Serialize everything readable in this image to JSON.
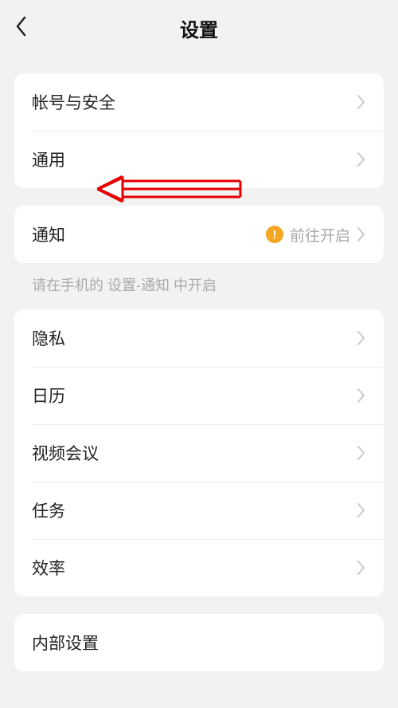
{
  "header": {
    "title": "设置"
  },
  "group1": {
    "items": [
      {
        "label": "帐号与安全"
      },
      {
        "label": "通用"
      }
    ]
  },
  "group2": {
    "items": [
      {
        "label": "通知",
        "secondary": "前往开启",
        "warning": true
      }
    ],
    "hint": "请在手机的 设置-通知 中开启"
  },
  "group3": {
    "items": [
      {
        "label": "隐私"
      },
      {
        "label": "日历"
      },
      {
        "label": "视频会议"
      },
      {
        "label": "任务"
      },
      {
        "label": "效率"
      }
    ]
  },
  "group4": {
    "items": [
      {
        "label": "内部设置"
      }
    ]
  }
}
